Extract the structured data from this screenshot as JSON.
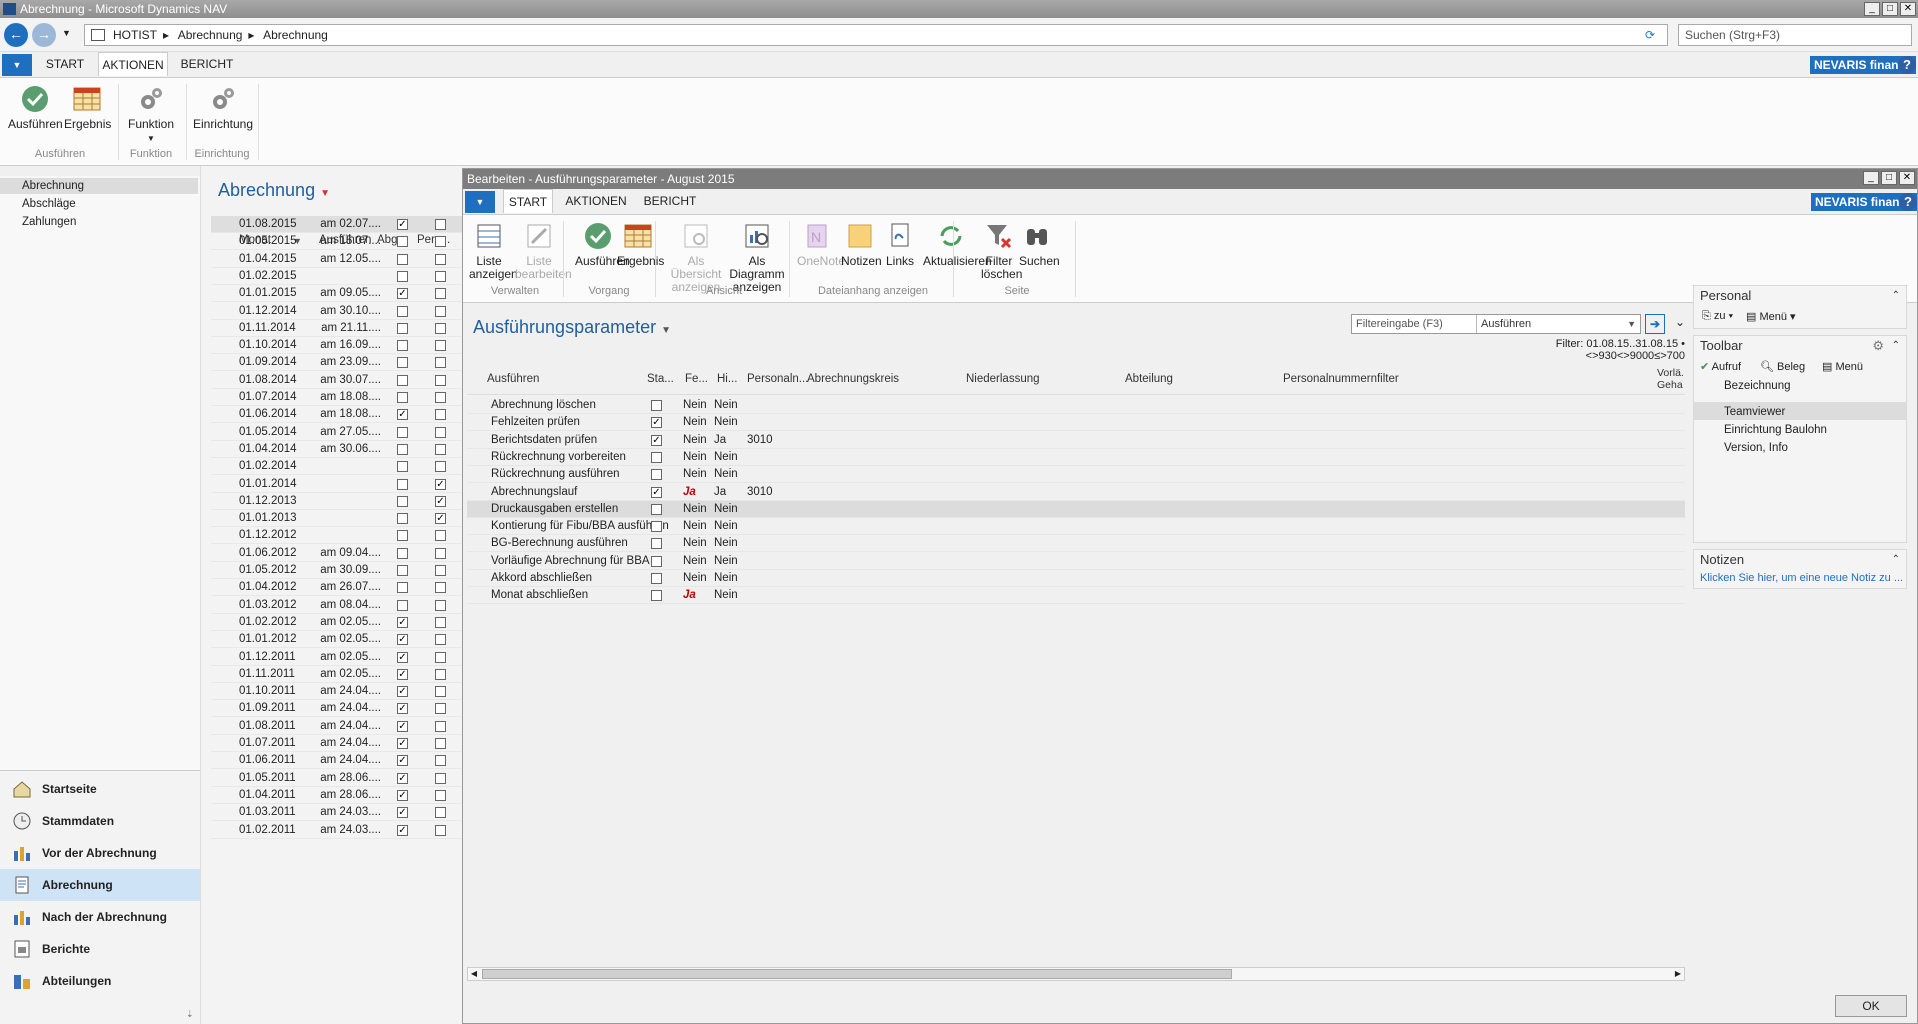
{
  "window": {
    "title": "Abrechnung - Microsoft Dynamics NAV"
  },
  "address": {
    "crumbs": [
      "HOTIST",
      "Abrechnung",
      "Abrechnung"
    ],
    "search_placeholder": "Suchen (Strg+F3)"
  },
  "tabs": [
    "START",
    "AKTIONEN",
    "BERICHT"
  ],
  "brand": {
    "nevaris": "NEVARIS finance",
    "help": "?"
  },
  "main_ribbon": {
    "buttons": [
      {
        "label": "Ausführen"
      },
      {
        "label": "Ergebnis"
      },
      {
        "label": "Funktion"
      },
      {
        "label": "Einrichtung"
      }
    ],
    "groups": [
      "Ausführen",
      "Funktion",
      "Einrichtung"
    ]
  },
  "left_nav": {
    "items": [
      "Abrechnung",
      "Abschläge",
      "Zahlungen"
    ]
  },
  "bottom_nav": {
    "items": [
      "Startseite",
      "Stammdaten",
      "Vor der Abrechnung",
      "Abrechnung",
      "Nach der Abrechnung",
      "Berichte",
      "Abteilungen"
    ]
  },
  "list": {
    "title": "Abrechnung",
    "headers": [
      "Monat",
      "Ausführen",
      "Abg...",
      "Pers..."
    ],
    "rows": [
      {
        "monat": "01.08.2015",
        "ausf": "am 02.07....",
        "abg": true,
        "pers": false
      },
      {
        "monat": "01.05.2015",
        "ausf": "am 15.07....",
        "abg": false,
        "pers": false
      },
      {
        "monat": "01.04.2015",
        "ausf": "am 12.05....",
        "abg": false,
        "pers": false
      },
      {
        "monat": "01.02.2015",
        "ausf": "",
        "abg": false,
        "pers": false
      },
      {
        "monat": "01.01.2015",
        "ausf": "am 09.05....",
        "abg": true,
        "pers": false
      },
      {
        "monat": "01.12.2014",
        "ausf": "am 30.10....",
        "abg": false,
        "pers": false
      },
      {
        "monat": "01.11.2014",
        "ausf": "am 21.11....",
        "abg": false,
        "pers": false
      },
      {
        "monat": "01.10.2014",
        "ausf": "am 16.09....",
        "abg": false,
        "pers": false
      },
      {
        "monat": "01.09.2014",
        "ausf": "am 23.09....",
        "abg": false,
        "pers": false
      },
      {
        "monat": "01.08.2014",
        "ausf": "am 30.07....",
        "abg": false,
        "pers": false
      },
      {
        "monat": "01.07.2014",
        "ausf": "am 18.08....",
        "abg": false,
        "pers": false
      },
      {
        "monat": "01.06.2014",
        "ausf": "am 18.08....",
        "abg": true,
        "pers": false
      },
      {
        "monat": "01.05.2014",
        "ausf": "am 27.05....",
        "abg": false,
        "pers": false
      },
      {
        "monat": "01.04.2014",
        "ausf": "am 30.06....",
        "abg": false,
        "pers": false
      },
      {
        "monat": "01.02.2014",
        "ausf": "",
        "abg": false,
        "pers": false
      },
      {
        "monat": "01.01.2014",
        "ausf": "",
        "abg": false,
        "pers": true
      },
      {
        "monat": "01.12.2013",
        "ausf": "",
        "abg": false,
        "pers": true
      },
      {
        "monat": "01.01.2013",
        "ausf": "",
        "abg": false,
        "pers": true
      },
      {
        "monat": "01.12.2012",
        "ausf": "",
        "abg": false,
        "pers": false
      },
      {
        "monat": "01.06.2012",
        "ausf": "am 09.04....",
        "abg": false,
        "pers": false
      },
      {
        "monat": "01.05.2012",
        "ausf": "am 30.09....",
        "abg": false,
        "pers": false
      },
      {
        "monat": "01.04.2012",
        "ausf": "am 26.07....",
        "abg": false,
        "pers": false
      },
      {
        "monat": "01.03.2012",
        "ausf": "am 08.04....",
        "abg": false,
        "pers": false
      },
      {
        "monat": "01.02.2012",
        "ausf": "am 02.05....",
        "abg": true,
        "pers": false
      },
      {
        "monat": "01.01.2012",
        "ausf": "am 02.05....",
        "abg": true,
        "pers": false
      },
      {
        "monat": "01.12.2011",
        "ausf": "am 02.05....",
        "abg": true,
        "pers": false
      },
      {
        "monat": "01.11.2011",
        "ausf": "am 02.05....",
        "abg": true,
        "pers": false
      },
      {
        "monat": "01.10.2011",
        "ausf": "am 24.04....",
        "abg": true,
        "pers": false
      },
      {
        "monat": "01.09.2011",
        "ausf": "am 24.04....",
        "abg": true,
        "pers": false
      },
      {
        "monat": "01.08.2011",
        "ausf": "am 24.04....",
        "abg": true,
        "pers": false
      },
      {
        "monat": "01.07.2011",
        "ausf": "am 24.04....",
        "abg": true,
        "pers": false
      },
      {
        "monat": "01.06.2011",
        "ausf": "am 24.04....",
        "abg": true,
        "pers": false
      },
      {
        "monat": "01.05.2011",
        "ausf": "am 28.06....",
        "abg": true,
        "pers": false
      },
      {
        "monat": "01.04.2011",
        "ausf": "am 28.06....",
        "abg": true,
        "pers": false
      },
      {
        "monat": "01.03.2011",
        "ausf": "am 24.03....",
        "abg": true,
        "pers": false
      },
      {
        "monat": "01.02.2011",
        "ausf": "am 24.03....",
        "abg": true,
        "pers": false
      }
    ]
  },
  "dialog": {
    "title": "Bearbeiten - Ausführungsparameter - August 2015",
    "ribbon_buttons": [
      {
        "l1": "Liste",
        "l2": "anzeigen"
      },
      {
        "l1": "Liste",
        "l2": "bearbeiten"
      },
      {
        "l1": "Ausführen",
        "l2": ""
      },
      {
        "l1": "Ergebnis",
        "l2": ""
      },
      {
        "l1": "Als Übersicht",
        "l2": "anzeigen"
      },
      {
        "l1": "Als Diagramm",
        "l2": "anzeigen"
      },
      {
        "l1": "OneNote",
        "l2": ""
      },
      {
        "l1": "Notizen",
        "l2": ""
      },
      {
        "l1": "Links",
        "l2": ""
      },
      {
        "l1": "Aktualisieren",
        "l2": ""
      },
      {
        "l1": "Filter",
        "l2": "löschen"
      },
      {
        "l1": "Suchen",
        "l2": ""
      }
    ],
    "ribbon_groups": [
      "Verwalten",
      "Vorgang",
      "Ansicht",
      "Dateianhang anzeigen",
      "Seite"
    ],
    "page_title": "Ausführungsparameter",
    "filter": {
      "placeholder": "Filtereingabe (F3)",
      "field": "Ausführen",
      "text": "Filter: 01.08.15..31.08.15 • <>930<>9000<u>&lt;</u>700"
    },
    "filter_text": "Filter: 01.08.15..31.08.15 • <>930<>9000≤>700",
    "headers": [
      "Ausführen",
      "Sta...",
      "Fe...",
      "Hi...",
      "Personaln...",
      "Abrechnungskreis",
      "Niederlassung",
      "Abteilung",
      "Personalnummernfilter",
      "Vorlä... Geha..."
    ],
    "rows": [
      {
        "name": "Abrechnung löschen",
        "sta": false,
        "fe": "Nein",
        "fe_ja": false,
        "hi": "Nein",
        "pn": ""
      },
      {
        "name": "Fehlzeiten prüfen",
        "sta": true,
        "fe": "Nein",
        "fe_ja": false,
        "hi": "Nein",
        "pn": ""
      },
      {
        "name": "Berichtsdaten prüfen",
        "sta": true,
        "fe": "Nein",
        "fe_ja": false,
        "hi": "Ja",
        "pn": "3010"
      },
      {
        "name": "Rückrechnung vorbereiten",
        "sta": false,
        "fe": "Nein",
        "fe_ja": false,
        "hi": "Nein",
        "pn": ""
      },
      {
        "name": "Rückrechnung ausführen",
        "sta": false,
        "fe": "Nein",
        "fe_ja": false,
        "hi": "Nein",
        "pn": ""
      },
      {
        "name": "Abrechnungslauf",
        "sta": true,
        "fe": "Ja",
        "fe_ja": true,
        "hi": "Ja",
        "pn": "3010"
      },
      {
        "name": "Druckausgaben erstellen",
        "sta": false,
        "fe": "Nein",
        "fe_ja": false,
        "hi": "Nein",
        "pn": ""
      },
      {
        "name": "Kontierung für Fibu/BBA ausführen",
        "sta": false,
        "fe": "Nein",
        "fe_ja": false,
        "hi": "Nein",
        "pn": ""
      },
      {
        "name": "BG-Berechnung ausführen",
        "sta": false,
        "fe": "Nein",
        "fe_ja": false,
        "hi": "Nein",
        "pn": ""
      },
      {
        "name": "Vorläufige Abrechnung für BBA",
        "sta": false,
        "fe": "Nein",
        "fe_ja": false,
        "hi": "Nein",
        "pn": ""
      },
      {
        "name": "Akkord abschließen",
        "sta": false,
        "fe": "Nein",
        "fe_ja": false,
        "hi": "Nein",
        "pn": ""
      },
      {
        "name": "Monat abschließen",
        "sta": false,
        "fe": "Ja",
        "fe_ja": true,
        "hi": "Nein",
        "pn": ""
      }
    ],
    "factbox_personal": {
      "title": "Personal",
      "zu": "zu",
      "menu": "Menü"
    },
    "factbox_toolbar": {
      "title": "Toolbar",
      "aufruf": "Aufruf",
      "beleg": "Beleg",
      "menu": "Menü",
      "items": [
        "Bezeichnung",
        "Teamviewer",
        "Einrichtung Baulohn",
        "Version, Info"
      ]
    },
    "factbox_notizen": {
      "title": "Notizen",
      "link": "Klicken Sie hier, um eine neue Notiz zu ..."
    },
    "ok": "OK"
  }
}
